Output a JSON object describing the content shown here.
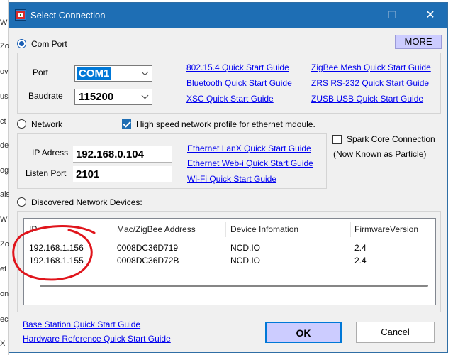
{
  "window": {
    "title": "Select Connection",
    "minimize": "—",
    "maximize": "☐",
    "close": "✕"
  },
  "background_strip": [
    "W",
    "Zo",
    "ov",
    "us",
    "ct",
    "de",
    "og",
    "ais",
    "W",
    "Zo",
    "et",
    "on",
    "ec",
    "X"
  ],
  "more_button": "MORE",
  "com_port": {
    "label": "Com Port",
    "port_label": "Port",
    "port_value": "COM1",
    "baud_label": "Baudrate",
    "baud_value": "115200",
    "links": [
      "802.15.4 Quick Start Guide",
      "ZigBee Mesh Quick Start Guide",
      "Bluetooth Quick Start Guide",
      "ZRS RS-232 Quick Start Guide",
      "XSC Quick Start Guide",
      "ZUSB USB Quick Start Guide"
    ]
  },
  "network": {
    "label": "Network",
    "high_speed_label": "High speed network profile for ethernet mdoule.",
    "ip_label": "IP Adress",
    "ip_value": "192.168.0.104",
    "port_label": "Listen Port",
    "port_value": "2101",
    "links": [
      "Ethernet LanX Quick Start Guide",
      "Ethernet Web-i Quick Start Guide",
      "Wi-Fi Quick Start Guide"
    ],
    "spark_label": "Spark Core Connection",
    "spark_note": "(Now Known as Particle)"
  },
  "discovered": {
    "label": "Discovered Network Devices:",
    "columns": [
      "IP",
      "Mac/ZigBee Address",
      "Device Infomation",
      "FirmwareVersion"
    ],
    "rows": [
      [
        "192.168.1.156",
        "0008DC36D719",
        "NCD.IO",
        "2.4"
      ],
      [
        "192.168.1.155",
        "0008DC36D72B",
        "NCD.IO",
        "2.4"
      ]
    ]
  },
  "footer": {
    "links": [
      "Base Station Quick Start Guide",
      "Hardware Reference Quick Start Guide"
    ],
    "ok": "OK",
    "cancel": "Cancel"
  },
  "colors": {
    "titlebar": "#1e6eb4",
    "annotation": "#e0151c",
    "ok_button": "#ccccff",
    "link": "#0000ee"
  }
}
